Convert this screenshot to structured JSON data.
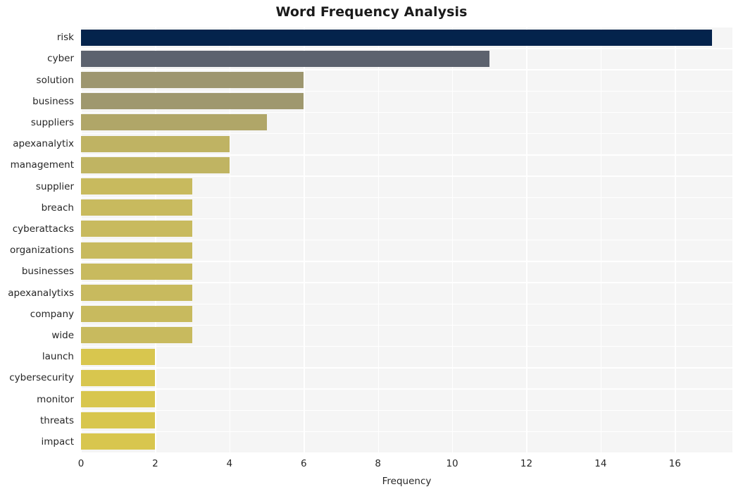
{
  "chart_data": {
    "type": "bar",
    "orientation": "horizontal",
    "title": "Word Frequency Analysis",
    "xlabel": "Frequency",
    "ylabel": "",
    "xlim": [
      0,
      17.55
    ],
    "xticks": [
      0,
      2,
      4,
      6,
      8,
      10,
      12,
      14,
      16
    ],
    "xticklabels": [
      "0",
      "2",
      "4",
      "6",
      "8",
      "10",
      "12",
      "14",
      "16"
    ],
    "grid": true,
    "legend": false,
    "categories": [
      "risk",
      "cyber",
      "solution",
      "business",
      "suppliers",
      "apexanalytix",
      "management",
      "supplier",
      "breach",
      "cyberattacks",
      "organizations",
      "businesses",
      "apexanalytixs",
      "company",
      "wide",
      "launch",
      "cybersecurity",
      "monitor",
      "threats",
      "impact"
    ],
    "values": [
      17,
      11,
      6,
      6,
      5,
      4,
      4,
      3,
      3,
      3,
      3,
      3,
      3,
      3,
      3,
      2,
      2,
      2,
      2,
      2
    ],
    "bar_colors": [
      "#04234c",
      "#5c626e",
      "#9d966f",
      "#9f986e",
      "#b0a668",
      "#bfb363",
      "#c0b462",
      "#c8ba5e",
      "#c8ba5e",
      "#c8ba5e",
      "#c8ba5e",
      "#c8ba5e",
      "#c8ba5e",
      "#c8ba5e",
      "#c8ba5e",
      "#d8c64e",
      "#d8c64e",
      "#d8c64e",
      "#d8c64e",
      "#d8c64e"
    ]
  },
  "style": {
    "plot_background": "#f5f5f5",
    "gridline_color": "#ffffff",
    "page_background": "#ffffff",
    "text_color": "#262626",
    "title_color": "#1a1a1a"
  }
}
